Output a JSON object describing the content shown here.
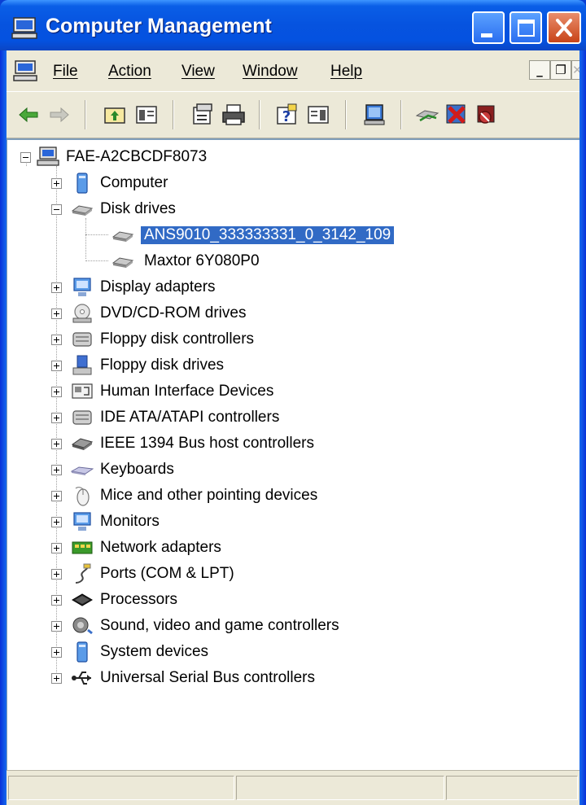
{
  "window": {
    "title": "Computer Management",
    "controls": {
      "minimize": "minimize",
      "maximize": "maximize",
      "close": "close"
    }
  },
  "menu": {
    "items": [
      "File",
      "Action",
      "View",
      "Window",
      "Help"
    ],
    "mdi": {
      "minimize": "_",
      "restore": "❐",
      "close": "✕"
    }
  },
  "toolbar": {
    "buttons": [
      "back-arrow-icon",
      "forward-arrow-icon",
      "up-folder-icon",
      "show-hide-tree-icon",
      "properties-icon",
      "print-icon",
      "help-icon",
      "show-hide-action-pane-icon",
      "scan-hardware-icon",
      "update-driver-icon",
      "uninstall-icon",
      "disable-icon"
    ]
  },
  "tree": {
    "root": "FAE-A2CBCDF8073",
    "items": [
      {
        "label": "Computer",
        "icon": "computer-icon",
        "expanded": false
      },
      {
        "label": "Disk drives",
        "icon": "disk-drive-icon",
        "expanded": true,
        "children": [
          {
            "label": "ANS9010_333333331_0_3142_109",
            "icon": "disk-drive-icon",
            "selected": true
          },
          {
            "label": "Maxtor 6Y080P0",
            "icon": "disk-drive-icon",
            "selected": false
          }
        ]
      },
      {
        "label": "Display adapters",
        "icon": "display-adapter-icon",
        "expanded": false
      },
      {
        "label": "DVD/CD-ROM drives",
        "icon": "dvd-drive-icon",
        "expanded": false
      },
      {
        "label": "Floppy disk controllers",
        "icon": "controller-icon",
        "expanded": false
      },
      {
        "label": "Floppy disk drives",
        "icon": "floppy-drive-icon",
        "expanded": false
      },
      {
        "label": "Human Interface Devices",
        "icon": "hid-icon",
        "expanded": false
      },
      {
        "label": "IDE ATA/ATAPI controllers",
        "icon": "controller-icon",
        "expanded": false
      },
      {
        "label": "IEEE 1394 Bus host controllers",
        "icon": "ieee1394-icon",
        "expanded": false
      },
      {
        "label": "Keyboards",
        "icon": "keyboard-icon",
        "expanded": false
      },
      {
        "label": "Mice and other pointing devices",
        "icon": "mouse-icon",
        "expanded": false
      },
      {
        "label": "Monitors",
        "icon": "monitor-icon",
        "expanded": false
      },
      {
        "label": "Network adapters",
        "icon": "network-adapter-icon",
        "expanded": false
      },
      {
        "label": "Ports (COM & LPT)",
        "icon": "port-icon",
        "expanded": false
      },
      {
        "label": "Processors",
        "icon": "processor-icon",
        "expanded": false
      },
      {
        "label": "Sound, video and game controllers",
        "icon": "sound-icon",
        "expanded": false
      },
      {
        "label": "System devices",
        "icon": "system-device-icon",
        "expanded": false
      },
      {
        "label": "Universal Serial Bus controllers",
        "icon": "usb-icon",
        "expanded": false
      }
    ]
  },
  "colors": {
    "title_bar": "#0653df",
    "selection": "#316ac5",
    "chrome": "#ece9d8"
  }
}
